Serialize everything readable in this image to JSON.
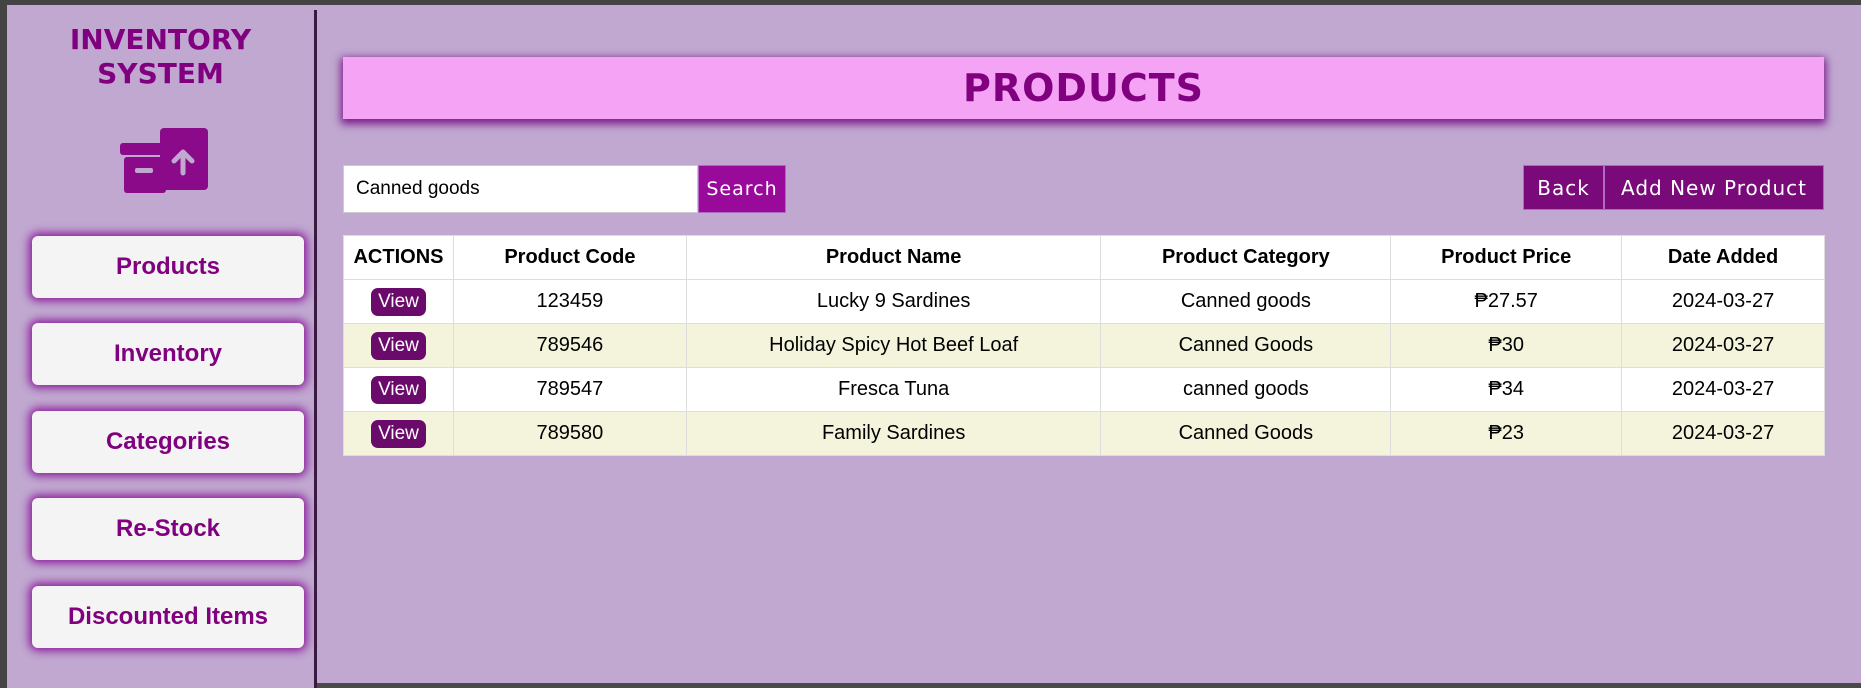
{
  "sidebar": {
    "brand_line1": "INVENTORY",
    "brand_line2": "SYSTEM",
    "brand_icon": "archive-box-upload-icon",
    "items": [
      {
        "label": "Products"
      },
      {
        "label": "Inventory"
      },
      {
        "label": "Categories"
      },
      {
        "label": "Re-Stock"
      },
      {
        "label": "Discounted Items"
      }
    ]
  },
  "header": {
    "title": "PRODUCTS"
  },
  "search": {
    "value": "Canned goods",
    "button_label": "Search"
  },
  "actions": {
    "back_label": "Back",
    "add_label": "Add New Product"
  },
  "table": {
    "columns": [
      "ACTIONS",
      "Product Code",
      "Product Name",
      "Product Category",
      "Product Price",
      "Date Added"
    ],
    "view_label": "View",
    "rows": [
      {
        "code": "123459",
        "name": "Lucky 9 Sardines",
        "category": "Canned goods",
        "price": "₱27.57",
        "date": "2024-03-27"
      },
      {
        "code": "789546",
        "name": "Holiday Spicy Hot Beef Loaf",
        "category": "Canned Goods",
        "price": "₱30",
        "date": "2024-03-27"
      },
      {
        "code": "789547",
        "name": "Fresca Tuna",
        "category": "canned goods",
        "price": "₱34",
        "date": "2024-03-27"
      },
      {
        "code": "789580",
        "name": "Family Sardines",
        "category": "Canned Goods",
        "price": "₱23",
        "date": "2024-03-27"
      }
    ]
  },
  "colors": {
    "background": "#c0a8d0",
    "accent": "#800080",
    "title_bar": "#f5a4f5",
    "button": "#7a0a7a",
    "row_alt": "#f4f4dc"
  }
}
